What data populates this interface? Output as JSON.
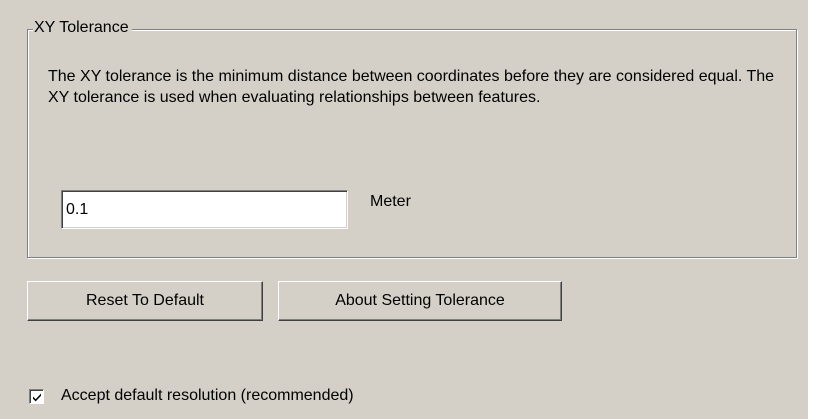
{
  "group": {
    "title": "XY Tolerance",
    "description": "The XY tolerance is the minimum distance between coordinates before they are considered equal. The XY tolerance is used when evaluating relationships between features."
  },
  "tolerance": {
    "value": "0.1",
    "unit": "Meter"
  },
  "buttons": {
    "reset_label": "Reset To Default",
    "about_label": "About Setting Tolerance"
  },
  "accept_default": {
    "label": "Accept default resolution  (recommended)",
    "checked": true
  },
  "colors": {
    "dialog_background": "#d4d0c8",
    "border_shadow": "#808080",
    "border_highlight": "#ffffff"
  }
}
